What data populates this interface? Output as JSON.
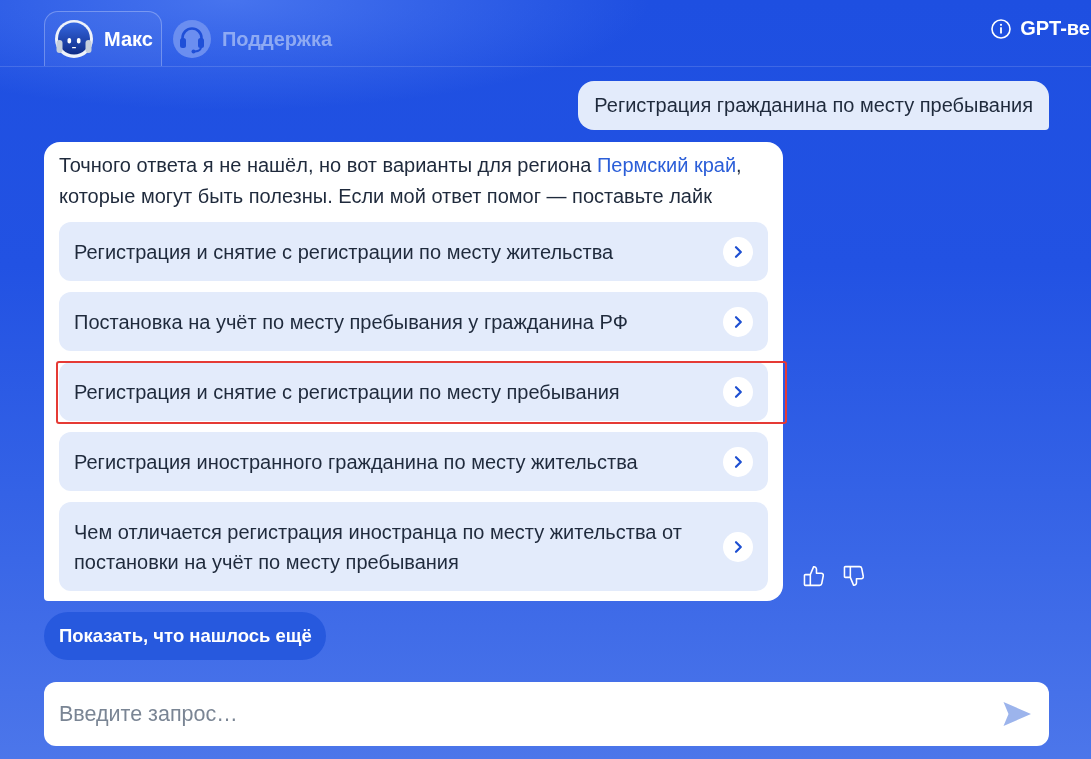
{
  "tabs": [
    {
      "kind": "bot",
      "label": "Макс",
      "selected": true
    },
    {
      "kind": "operator",
      "label": "Поддержка",
      "selected": false
    }
  ],
  "header_link": {
    "label": "GPT-ве"
  },
  "messages": [
    {
      "kind": "user",
      "text": "Регистрация гражданина по месту пребывания"
    },
    {
      "kind": "bot",
      "text_before": "Точного ответа я не нашёл, но вот варианты для региона ",
      "link": "Пермский край",
      "text_after": ", которые могут быть полезны. Если мой ответ помог — поставьте лайк",
      "options": [
        {
          "label": "Регистрация и снятие с регистрации по месту жительства",
          "highlighted": false
        },
        {
          "label": "Постановка на учёт по месту пребывания у гражданина РФ",
          "highlighted": false
        },
        {
          "label": "Регистрация и снятие с регистрации по месту пребывания",
          "highlighted": true
        },
        {
          "label": "Регистрация иностранного гражданина по месту жительства",
          "highlighted": false
        },
        {
          "label": "Чем отличается регистрация иностранца по месту жительства от постановки на учёт по месту пребывания",
          "highlighted": false
        }
      ]
    }
  ],
  "more_button": {
    "label": "Показать, что нашлось ещё"
  },
  "input": {
    "placeholder": "Введите запрос…"
  }
}
